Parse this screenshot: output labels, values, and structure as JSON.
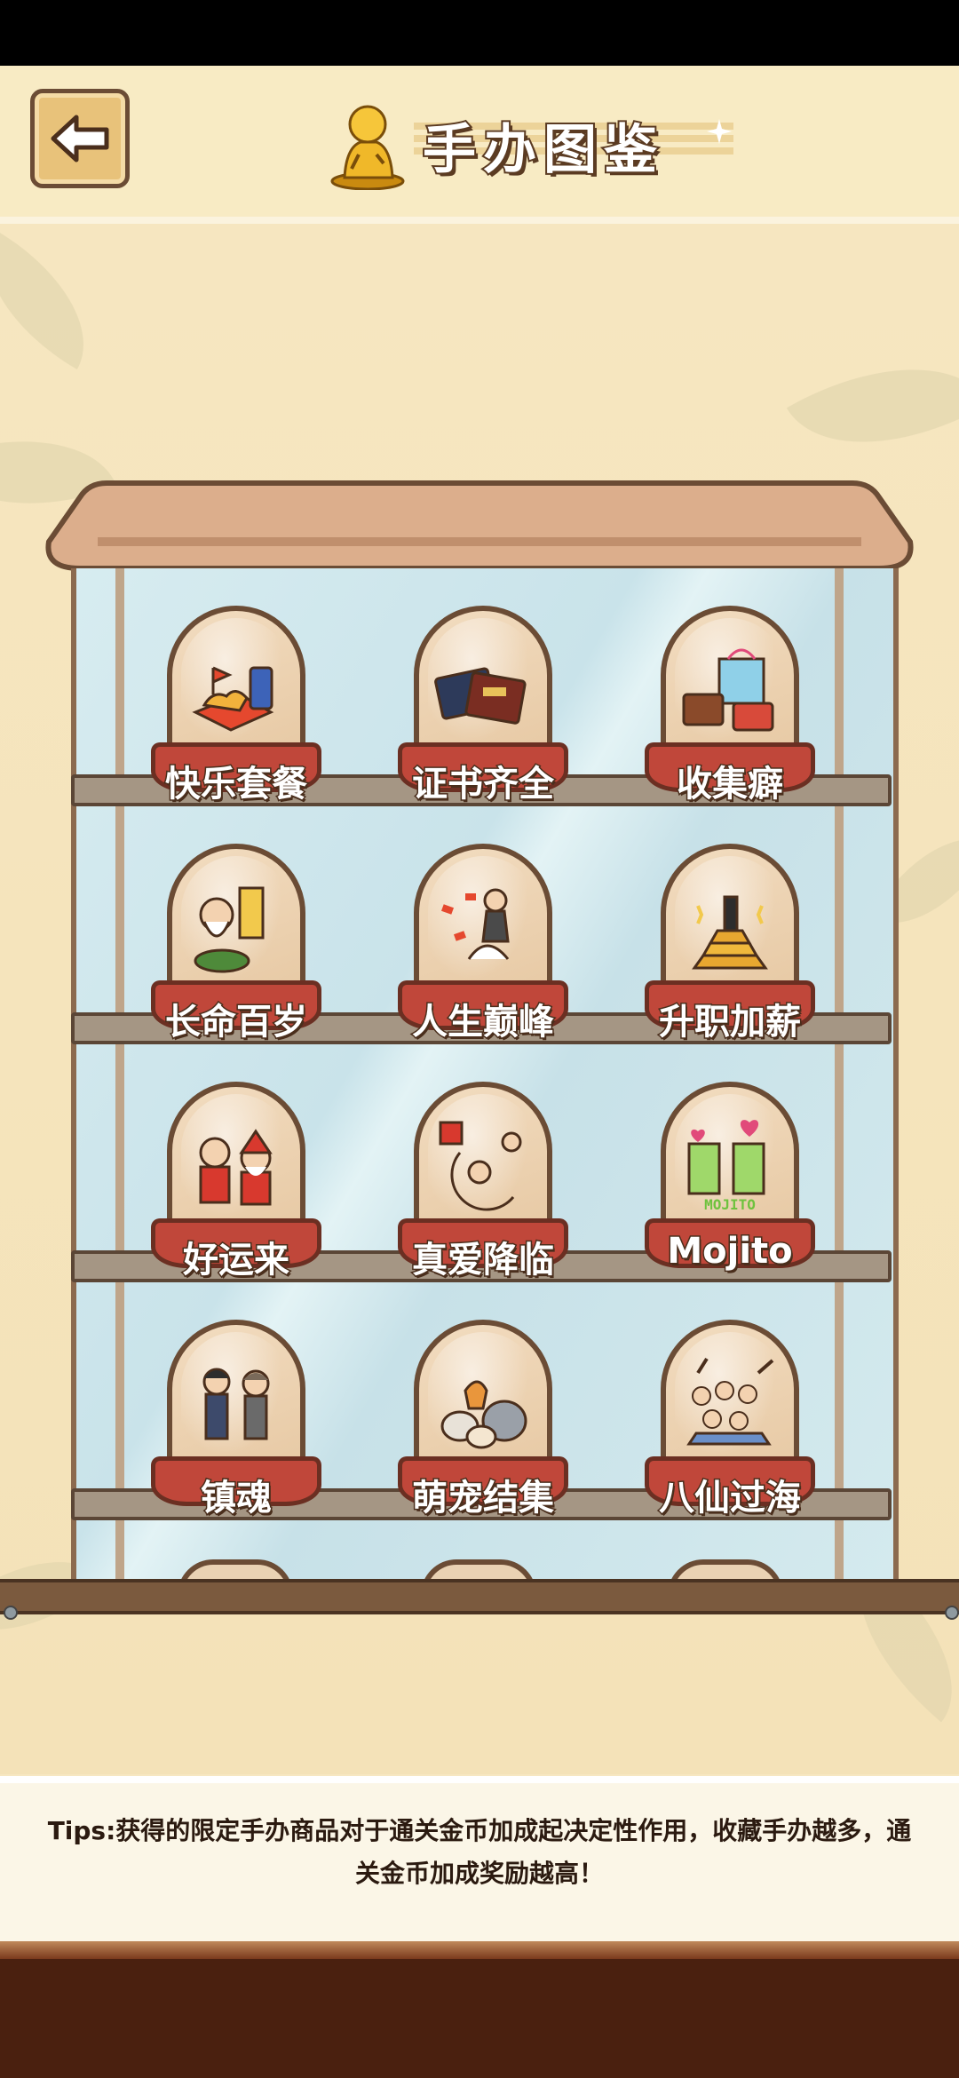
{
  "header": {
    "title": "手办图鉴",
    "back_icon": "arrow-left-icon",
    "title_icon": "golden-figurine-icon"
  },
  "figures": [
    {
      "label": "快乐套餐",
      "art": "fast-food-meal"
    },
    {
      "label": "证书齐全",
      "art": "certificates"
    },
    {
      "label": "收集癖",
      "art": "shopping-bags"
    },
    {
      "label": "长命百岁",
      "art": "old-man-turtle"
    },
    {
      "label": "人生巅峰",
      "art": "money-shower"
    },
    {
      "label": "升职加薪",
      "art": "gold-bars"
    },
    {
      "label": "好运来",
      "art": "fortune-gods"
    },
    {
      "label": "真爱降临",
      "art": "cupid-moon"
    },
    {
      "label": "Mojito",
      "art": "mojito-drinks",
      "sign": "MOJITO"
    },
    {
      "label": "镇魂",
      "art": "two-men"
    },
    {
      "label": "萌宠结集",
      "art": "cats-group"
    },
    {
      "label": "八仙过海",
      "art": "eight-immortals"
    }
  ],
  "tips": {
    "text": "Tips:获得的限定手办商品对于通关金币加成起决定性作用，收藏手办越多，通关金币加成奖励越高！"
  },
  "colors": {
    "header_bg": "#f8ebc4",
    "page_bg": "#f6e6c0",
    "base_red": "#c0473a",
    "outline_brown": "#6b4c35",
    "floor": "#4a200f"
  }
}
